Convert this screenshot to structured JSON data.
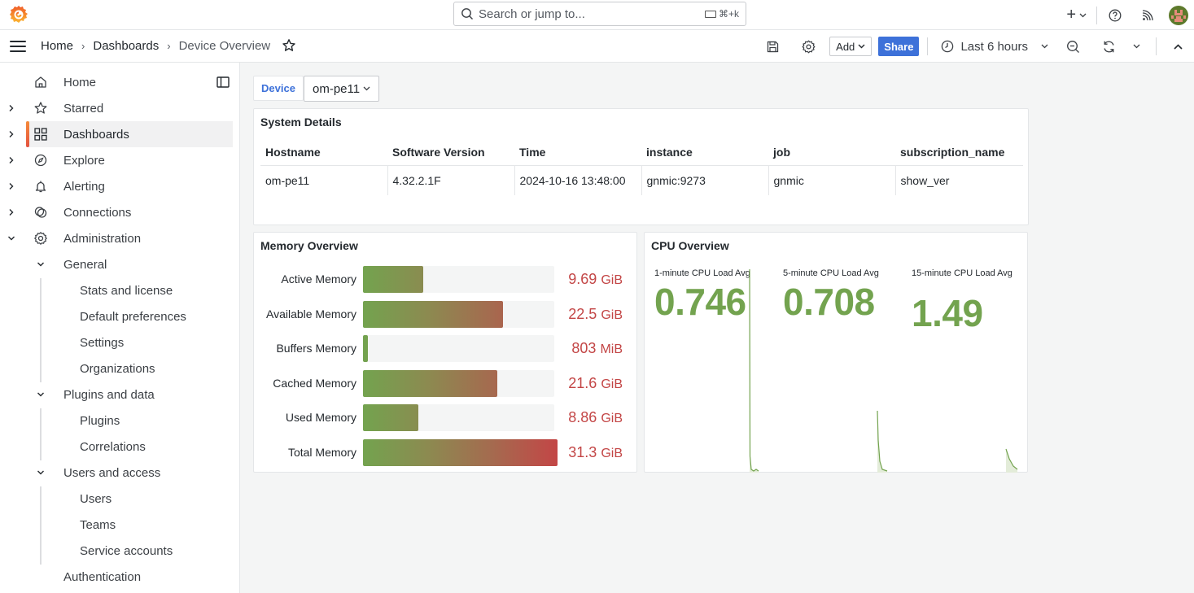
{
  "topbar": {
    "logo": "grafana-logo",
    "search_placeholder": "Search or jump to...",
    "search_shortcut": "⌘+k",
    "new_button": "+",
    "help": "help-icon",
    "news": "rss-icon",
    "avatar": "user-avatar"
  },
  "navbar": {
    "breadcrumb": [
      {
        "label": "Home"
      },
      {
        "label": "Dashboards"
      },
      {
        "label": "Device Overview"
      }
    ],
    "add_label": "Add",
    "share_label": "Share",
    "time_range": "Last 6 hours"
  },
  "sidebar": {
    "items": [
      {
        "label": "Home",
        "icon": "home-icon"
      },
      {
        "label": "Starred",
        "icon": "star-icon"
      },
      {
        "label": "Dashboards",
        "icon": "apps-icon",
        "active": true
      },
      {
        "label": "Explore",
        "icon": "compass-icon"
      },
      {
        "label": "Alerting",
        "icon": "bell-icon"
      },
      {
        "label": "Connections",
        "icon": "connections-icon"
      },
      {
        "label": "Administration",
        "icon": "gear-icon"
      }
    ],
    "admin": {
      "general": {
        "label": "General",
        "children": [
          "Stats and license",
          "Default preferences",
          "Settings",
          "Organizations"
        ]
      },
      "plugins": {
        "label": "Plugins and data",
        "children": [
          "Plugins",
          "Correlations"
        ]
      },
      "users": {
        "label": "Users and access",
        "children": [
          "Users",
          "Teams",
          "Service accounts"
        ]
      },
      "auth": {
        "label": "Authentication"
      }
    }
  },
  "variables": {
    "device_label": "Device",
    "device_value": "om-pe11"
  },
  "system_details": {
    "title": "System Details",
    "columns": [
      "Hostname",
      "Software Version",
      "Time",
      "instance",
      "job",
      "subscription_name"
    ],
    "rows": [
      [
        "om-pe11",
        "4.32.2.1F",
        "2024-10-16 13:48:00",
        "gnmic:9273",
        "gnmic",
        "show_ver"
      ]
    ]
  },
  "memory": {
    "title": "Memory Overview",
    "max_gib": 31.3,
    "rows": [
      {
        "label": "Active Memory",
        "value": "9.69",
        "unit": "GiB",
        "gib": 9.69
      },
      {
        "label": "Available Memory",
        "value": "22.5",
        "unit": "GiB",
        "gib": 22.5
      },
      {
        "label": "Buffers Memory",
        "value": "803",
        "unit": "MiB",
        "gib": 0.784
      },
      {
        "label": "Cached Memory",
        "value": "21.6",
        "unit": "GiB",
        "gib": 21.6
      },
      {
        "label": "Used Memory",
        "value": "8.86",
        "unit": "GiB",
        "gib": 8.86
      },
      {
        "label": "Total Memory",
        "value": "31.3",
        "unit": "GiB",
        "gib": 31.3
      }
    ]
  },
  "cpu": {
    "title": "CPU Overview",
    "stats": [
      {
        "title": "1-minute CPU Load Avg",
        "value": "0.746"
      },
      {
        "title": "5-minute CPU Load Avg",
        "value": "0.708"
      },
      {
        "title": "15-minute CPU Load Avg",
        "value": "1.49"
      }
    ]
  },
  "colors": {
    "accent": "#3d71d9",
    "ok_green": "#73a34f",
    "bad_red": "#c34646",
    "active_marker": "#f05a28"
  }
}
